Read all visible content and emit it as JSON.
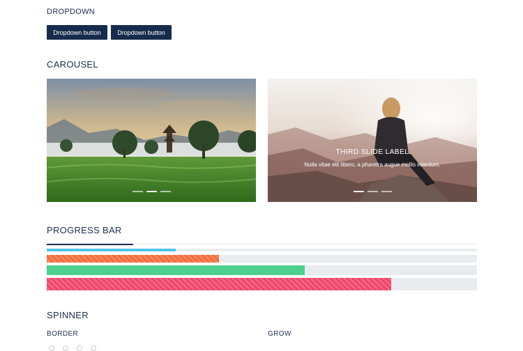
{
  "dropdown": {
    "title": "DROPDOWN",
    "buttons": [
      "Dropdown button",
      "Dropdown button"
    ]
  },
  "carousel": {
    "title": "CAROUSEL",
    "slides": [
      {
        "image": "tea-plantation-landscape",
        "caption_title": "",
        "caption_text": ""
      },
      {
        "image": "woman-sitting-on-mountain-rock",
        "caption_title": "THIRD SLIDE LABEL",
        "caption_text": "Nulla vitae elit libero, a pharetra augue mollis interdum."
      }
    ]
  },
  "progress": {
    "title": "PROGRESS BAR",
    "bars": [
      {
        "value": 30,
        "color": "#4fc3e8"
      },
      {
        "value": 40,
        "color": "#f26b3a"
      },
      {
        "value": 60,
        "color": "#4cd08c"
      },
      {
        "value": 80,
        "color": "#f0436a"
      }
    ]
  },
  "spinner": {
    "title": "SPINNER",
    "border_label": "BORDER",
    "grow_label": "GROW"
  },
  "colors": {
    "navy": "#172b4d",
    "track": "#e9ecef"
  }
}
